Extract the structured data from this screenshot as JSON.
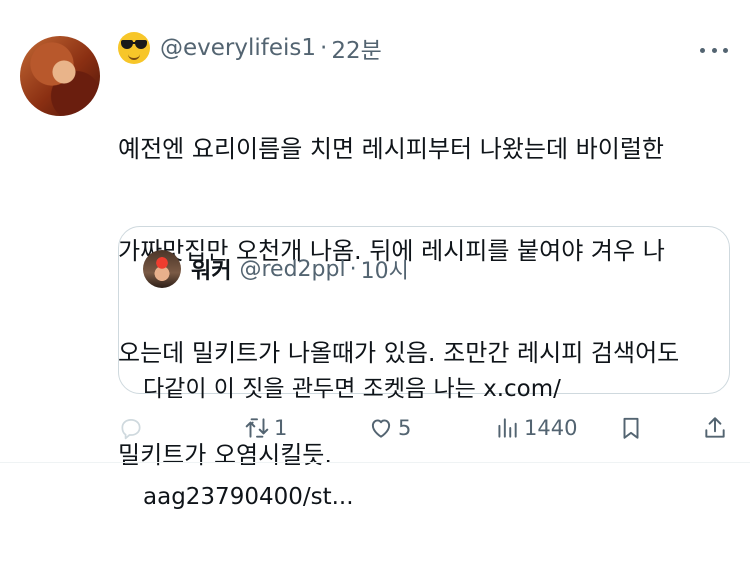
{
  "tweet": {
    "handle": "@everylifeis1",
    "separator": "·",
    "time": "22분",
    "text_lines": [
      "예전엔 요리이름을 치면 레시피부터 나왔는데 바이럴한",
      "가짜맛집만 오천개 나옴. 뒤에 레시피를 붙여야 겨우 나",
      "오는데 밀키트가 나올때가 있음. 조만간 레시피 검색어도",
      "밀키트가 오염시킬듯."
    ],
    "emoji_icon": "sunglasses-face-emoji"
  },
  "quote": {
    "name": "워커",
    "handle": "@red2ppl",
    "separator": "·",
    "time": "10시",
    "text_lines": [
      "다같이 이 짓을 관두면 조켓음 나는 x.com/",
      "aag23790400/st..."
    ]
  },
  "actions": {
    "reply_count": "",
    "retweet_count": "1",
    "like_count": "5",
    "views_count": "1440"
  },
  "colors": {
    "text": "#0f1419",
    "muted": "#536471",
    "border": "#cfd9de"
  }
}
